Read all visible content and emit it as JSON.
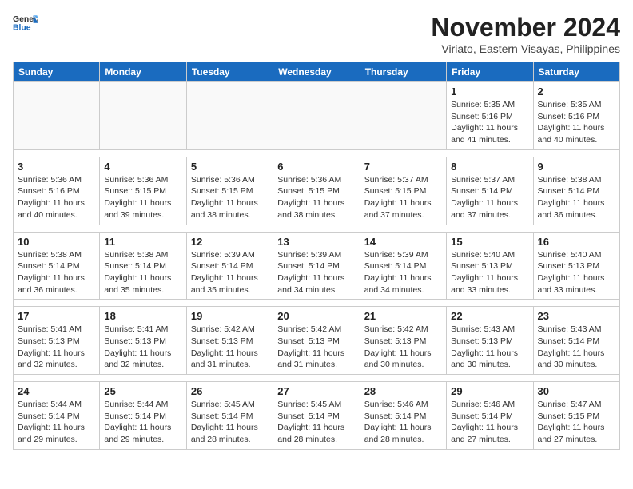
{
  "header": {
    "logo_line1": "General",
    "logo_line2": "Blue",
    "month": "November 2024",
    "location": "Viriato, Eastern Visayas, Philippines"
  },
  "weekdays": [
    "Sunday",
    "Monday",
    "Tuesday",
    "Wednesday",
    "Thursday",
    "Friday",
    "Saturday"
  ],
  "weeks": [
    [
      {
        "day": "",
        "info": ""
      },
      {
        "day": "",
        "info": ""
      },
      {
        "day": "",
        "info": ""
      },
      {
        "day": "",
        "info": ""
      },
      {
        "day": "",
        "info": ""
      },
      {
        "day": "1",
        "info": "Sunrise: 5:35 AM\nSunset: 5:16 PM\nDaylight: 11 hours and 41 minutes."
      },
      {
        "day": "2",
        "info": "Sunrise: 5:35 AM\nSunset: 5:16 PM\nDaylight: 11 hours and 40 minutes."
      }
    ],
    [
      {
        "day": "3",
        "info": "Sunrise: 5:36 AM\nSunset: 5:16 PM\nDaylight: 11 hours and 40 minutes."
      },
      {
        "day": "4",
        "info": "Sunrise: 5:36 AM\nSunset: 5:15 PM\nDaylight: 11 hours and 39 minutes."
      },
      {
        "day": "5",
        "info": "Sunrise: 5:36 AM\nSunset: 5:15 PM\nDaylight: 11 hours and 38 minutes."
      },
      {
        "day": "6",
        "info": "Sunrise: 5:36 AM\nSunset: 5:15 PM\nDaylight: 11 hours and 38 minutes."
      },
      {
        "day": "7",
        "info": "Sunrise: 5:37 AM\nSunset: 5:15 PM\nDaylight: 11 hours and 37 minutes."
      },
      {
        "day": "8",
        "info": "Sunrise: 5:37 AM\nSunset: 5:14 PM\nDaylight: 11 hours and 37 minutes."
      },
      {
        "day": "9",
        "info": "Sunrise: 5:38 AM\nSunset: 5:14 PM\nDaylight: 11 hours and 36 minutes."
      }
    ],
    [
      {
        "day": "10",
        "info": "Sunrise: 5:38 AM\nSunset: 5:14 PM\nDaylight: 11 hours and 36 minutes."
      },
      {
        "day": "11",
        "info": "Sunrise: 5:38 AM\nSunset: 5:14 PM\nDaylight: 11 hours and 35 minutes."
      },
      {
        "day": "12",
        "info": "Sunrise: 5:39 AM\nSunset: 5:14 PM\nDaylight: 11 hours and 35 minutes."
      },
      {
        "day": "13",
        "info": "Sunrise: 5:39 AM\nSunset: 5:14 PM\nDaylight: 11 hours and 34 minutes."
      },
      {
        "day": "14",
        "info": "Sunrise: 5:39 AM\nSunset: 5:14 PM\nDaylight: 11 hours and 34 minutes."
      },
      {
        "day": "15",
        "info": "Sunrise: 5:40 AM\nSunset: 5:13 PM\nDaylight: 11 hours and 33 minutes."
      },
      {
        "day": "16",
        "info": "Sunrise: 5:40 AM\nSunset: 5:13 PM\nDaylight: 11 hours and 33 minutes."
      }
    ],
    [
      {
        "day": "17",
        "info": "Sunrise: 5:41 AM\nSunset: 5:13 PM\nDaylight: 11 hours and 32 minutes."
      },
      {
        "day": "18",
        "info": "Sunrise: 5:41 AM\nSunset: 5:13 PM\nDaylight: 11 hours and 32 minutes."
      },
      {
        "day": "19",
        "info": "Sunrise: 5:42 AM\nSunset: 5:13 PM\nDaylight: 11 hours and 31 minutes."
      },
      {
        "day": "20",
        "info": "Sunrise: 5:42 AM\nSunset: 5:13 PM\nDaylight: 11 hours and 31 minutes."
      },
      {
        "day": "21",
        "info": "Sunrise: 5:42 AM\nSunset: 5:13 PM\nDaylight: 11 hours and 30 minutes."
      },
      {
        "day": "22",
        "info": "Sunrise: 5:43 AM\nSunset: 5:13 PM\nDaylight: 11 hours and 30 minutes."
      },
      {
        "day": "23",
        "info": "Sunrise: 5:43 AM\nSunset: 5:14 PM\nDaylight: 11 hours and 30 minutes."
      }
    ],
    [
      {
        "day": "24",
        "info": "Sunrise: 5:44 AM\nSunset: 5:14 PM\nDaylight: 11 hours and 29 minutes."
      },
      {
        "day": "25",
        "info": "Sunrise: 5:44 AM\nSunset: 5:14 PM\nDaylight: 11 hours and 29 minutes."
      },
      {
        "day": "26",
        "info": "Sunrise: 5:45 AM\nSunset: 5:14 PM\nDaylight: 11 hours and 28 minutes."
      },
      {
        "day": "27",
        "info": "Sunrise: 5:45 AM\nSunset: 5:14 PM\nDaylight: 11 hours and 28 minutes."
      },
      {
        "day": "28",
        "info": "Sunrise: 5:46 AM\nSunset: 5:14 PM\nDaylight: 11 hours and 28 minutes."
      },
      {
        "day": "29",
        "info": "Sunrise: 5:46 AM\nSunset: 5:14 PM\nDaylight: 11 hours and 27 minutes."
      },
      {
        "day": "30",
        "info": "Sunrise: 5:47 AM\nSunset: 5:15 PM\nDaylight: 11 hours and 27 minutes."
      }
    ]
  ]
}
